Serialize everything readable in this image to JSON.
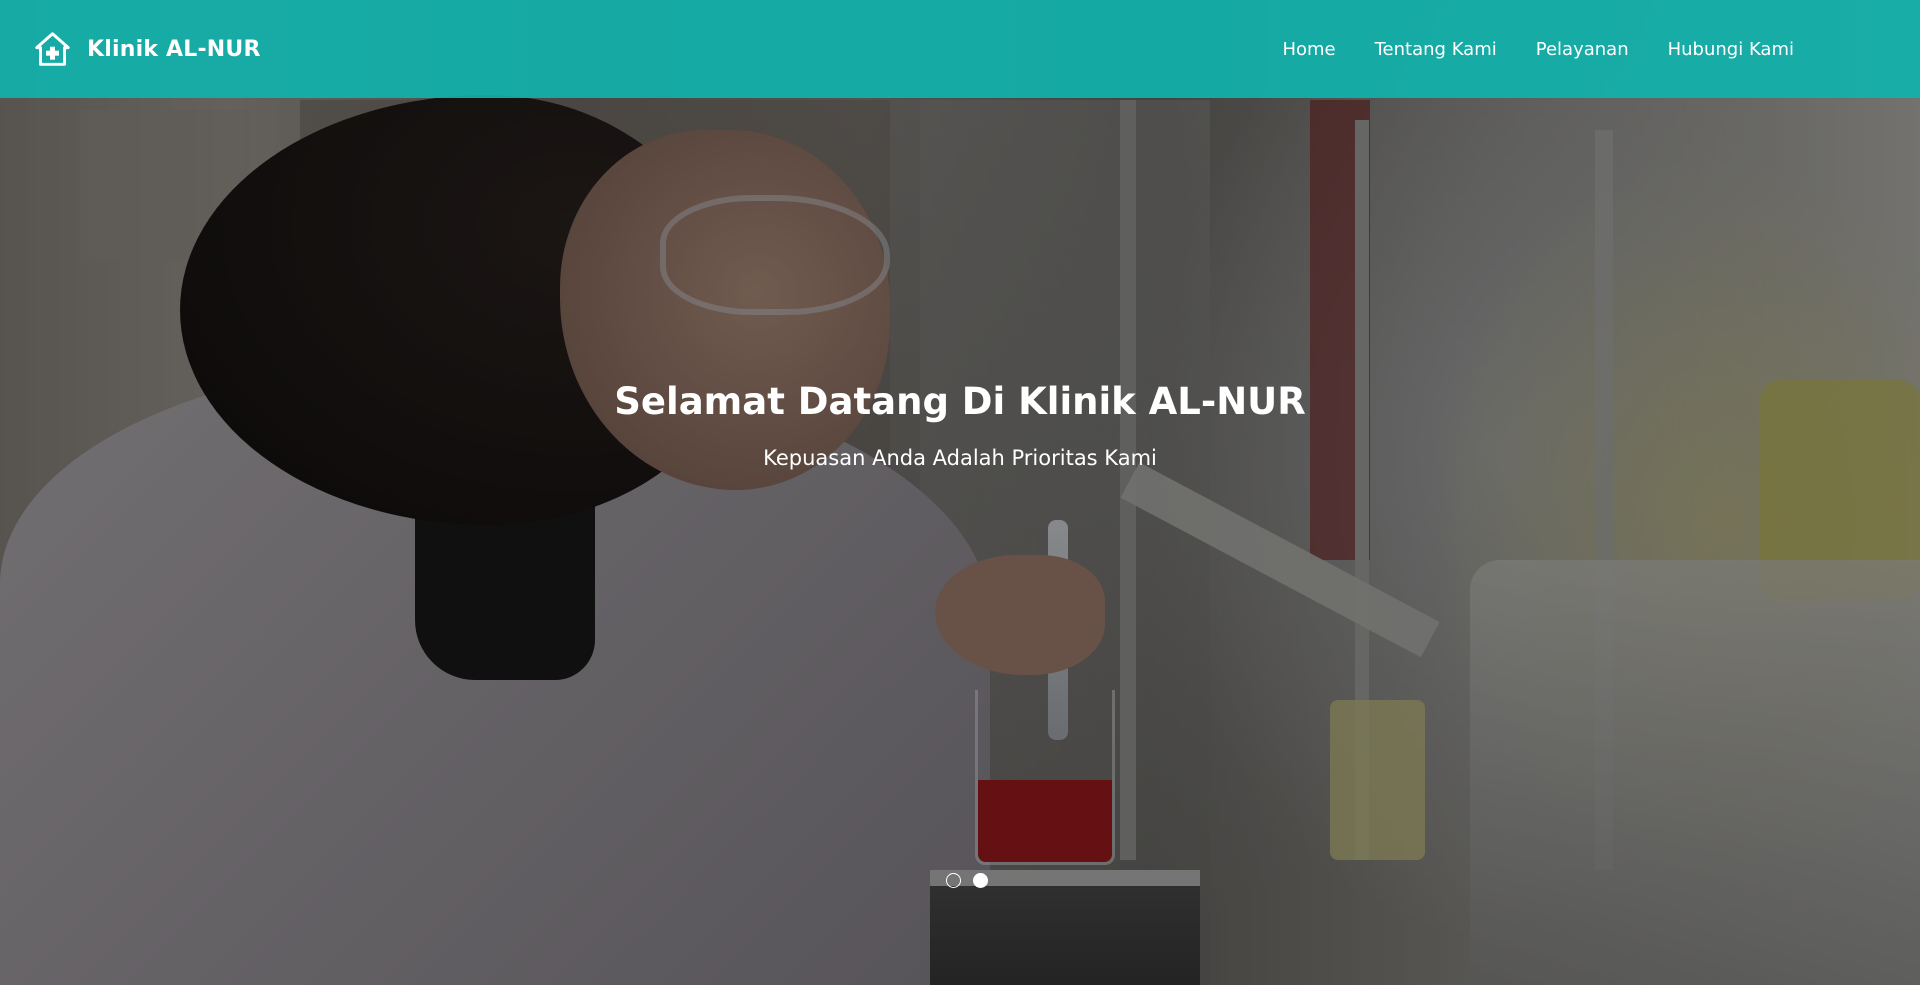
{
  "brand": {
    "icon": "clinic-house-cross-icon",
    "name": "Klinik AL-NUR"
  },
  "nav": {
    "items": [
      {
        "label": "Home"
      },
      {
        "label": "Tentang Kami"
      },
      {
        "label": "Pelayanan"
      },
      {
        "label": "Hubungi Kami"
      }
    ]
  },
  "hero": {
    "title": "Selamat Datang Di Klinik AL-NUR",
    "subtitle": "Kepuasan Anda Adalah Prioritas Kami",
    "image": "scientist-in-laboratory-photo",
    "slides_total": 2,
    "active_slide": 2
  },
  "colors": {
    "navbar": "#11b2ac",
    "text": "#ffffff"
  }
}
